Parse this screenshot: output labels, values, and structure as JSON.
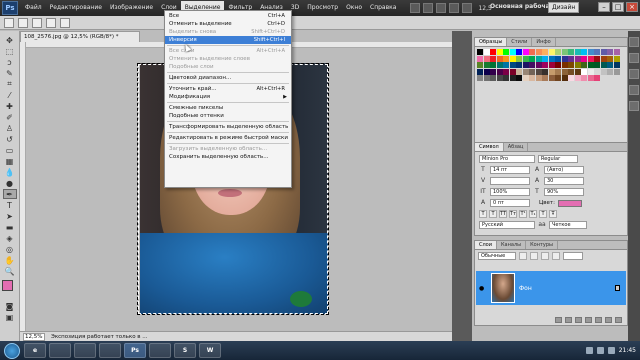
{
  "app": {
    "logo": "Ps",
    "menu": [
      "Файл",
      "Редактирование",
      "Изображение",
      "Слои",
      "Выделение",
      "Фильтр",
      "Анализ",
      "3D",
      "Просмотр",
      "Окно",
      "Справка"
    ],
    "active_menu": "Выделение",
    "zoom": "12,5",
    "workspace": "Основная рабочая среда",
    "workspace_button": "Дизайн"
  },
  "document": {
    "tab_title": "108_2576.jpg @ 12,5% (RGB/8*) *",
    "status_zoom": "12,5%",
    "status_text": "Экспозиция работает только в ..."
  },
  "selection_menu": {
    "items": [
      {
        "label": "Все",
        "shortcut": "Ctrl+A",
        "state": "normal"
      },
      {
        "label": "Отменить выделение",
        "shortcut": "Ctrl+D",
        "state": "normal"
      },
      {
        "label": "Выделить снова",
        "shortcut": "Shift+Ctrl+D",
        "state": "disabled"
      },
      {
        "label": "Инверсия",
        "shortcut": "Shift+Ctrl+I",
        "state": "highlight"
      },
      {
        "sep": true
      },
      {
        "label": "Все слои",
        "shortcut": "Alt+Ctrl+A",
        "state": "disabled"
      },
      {
        "label": "Отменить выделение слоев",
        "shortcut": "",
        "state": "disabled"
      },
      {
        "label": "Подобные слои",
        "shortcut": "",
        "state": "disabled"
      },
      {
        "sep": true
      },
      {
        "label": "Цветовой диапазон...",
        "shortcut": "",
        "state": "normal"
      },
      {
        "sep": true
      },
      {
        "label": "Уточнить край...",
        "shortcut": "Alt+Ctrl+R",
        "state": "normal"
      },
      {
        "label": "Модификация",
        "shortcut": "",
        "state": "normal",
        "submenu": true
      },
      {
        "sep": true
      },
      {
        "label": "Смежные пикселы",
        "shortcut": "",
        "state": "normal"
      },
      {
        "label": "Подобные оттенки",
        "shortcut": "",
        "state": "normal"
      },
      {
        "sep": true
      },
      {
        "label": "Трансформировать выделенную область",
        "shortcut": "",
        "state": "normal"
      },
      {
        "sep": true
      },
      {
        "label": "Редактировать в режиме быстрой маски",
        "shortcut": "",
        "state": "normal"
      },
      {
        "sep": true
      },
      {
        "label": "Загрузить выделенную область...",
        "shortcut": "",
        "state": "disabled"
      },
      {
        "label": "Сохранить выделенную область...",
        "shortcut": "",
        "state": "normal"
      }
    ]
  },
  "swatches_panel": {
    "tabs": [
      "Образцы",
      "Стили",
      "Инфо"
    ],
    "colors": [
      "#000000",
      "#ffffff",
      "#ff0000",
      "#ffff00",
      "#00ff00",
      "#00ffff",
      "#0000ff",
      "#ff00ff",
      "#f26c4f",
      "#f68e56",
      "#fbaf5d",
      "#fff568",
      "#acd372",
      "#7cc576",
      "#3bb878",
      "#1abbb4",
      "#00bff3",
      "#438ccb",
      "#5574b9",
      "#605ca8",
      "#855fa8",
      "#a763a8",
      "#f06eaa",
      "#f26d7d",
      "#ed1c24",
      "#f26522",
      "#f7941d",
      "#fff200",
      "#8dc63f",
      "#39b54a",
      "#00a651",
      "#00a99d",
      "#00aeef",
      "#0072bc",
      "#0054a6",
      "#2e3192",
      "#662d91",
      "#92278f",
      "#ec008c",
      "#ed145b",
      "#9e0b0f",
      "#a0410d",
      "#a36209",
      "#aba000",
      "#598527",
      "#197b30",
      "#007236",
      "#00746b",
      "#0076a3",
      "#004a80",
      "#003471",
      "#1b1464",
      "#440e62",
      "#630460",
      "#9e005d",
      "#9e0039",
      "#790000",
      "#7b2e00",
      "#7d4900",
      "#827b00",
      "#406618",
      "#005e20",
      "#005826",
      "#005952",
      "#005b7f",
      "#003663",
      "#002157",
      "#0d004c",
      "#32004b",
      "#4b0049",
      "#7b0046",
      "#7a0026",
      "#c7b299",
      "#998675",
      "#736357",
      "#534741",
      "#37302d",
      "#c69c6d",
      "#a67c52",
      "#8c6239",
      "#754c24",
      "#603913",
      "#ffffff",
      "#ebebeb",
      "#d7d7d7",
      "#c2c2c2",
      "#adadad",
      "#999999",
      "#858585",
      "#707070",
      "#5c5c5c",
      "#474747",
      "#333333",
      "#1f1f1f",
      "#0a0a0a",
      "#e5d1c0",
      "#d9b8a0",
      "#c49a7a",
      "#a87b5a",
      "#8c5e3c",
      "#704420",
      "#542d0c",
      "#f9d9e4",
      "#f4b3c8",
      "#ef8dad",
      "#ea6791",
      "#e54176"
    ]
  },
  "character_panel": {
    "tabs": [
      "Символ",
      "Абзац"
    ],
    "font_family": "Minion Pro",
    "font_style": "Regular",
    "size": "14 пт",
    "leading": "(Авто)",
    "kerning": "",
    "tracking": "30",
    "vscale": "100%",
    "hscale": "90%",
    "baseline": "0 пт",
    "color_label": "Цвет:",
    "color": "#e36db2",
    "language": "Русский",
    "antialias": "Четкое"
  },
  "layers_panel": {
    "tabs": [
      "Слои",
      "Каналы",
      "Контуры"
    ],
    "blend_mode": "Обычные",
    "layer_name": "Фон"
  },
  "taskbar": {
    "apps": [
      "e",
      "",
      "",
      "",
      "Ps",
      "",
      "S",
      "W"
    ],
    "active_app": "Ps",
    "clock": "21:45"
  }
}
